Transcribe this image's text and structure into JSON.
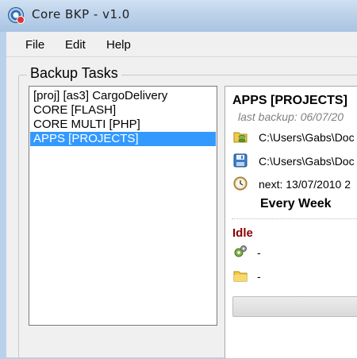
{
  "window": {
    "title": "Core BKP - v1.0"
  },
  "menu": {
    "file": "File",
    "edit": "Edit",
    "help": "Help"
  },
  "group": {
    "title": "Backup Tasks"
  },
  "tasks": [
    {
      "label": "[proj] [as3] CargoDelivery",
      "selected": false
    },
    {
      "label": "CORE [FLASH]",
      "selected": false
    },
    {
      "label": "CORE MULTI [PHP]",
      "selected": false
    },
    {
      "label": "APPS [PROJECTS]",
      "selected": true
    }
  ],
  "detail": {
    "title": "APPS [PROJECTS]",
    "last_backup": "last backup: 06/07/20",
    "source_path": "C:\\Users\\Gabs\\Doc",
    "dest_path": "C:\\Users\\Gabs\\Doc",
    "next": "next: 13/07/2010 2",
    "schedule": "Every Week",
    "status": "Idle",
    "activity": "-",
    "current_file": "-"
  },
  "icons": {
    "app": "core-bkp-app-icon",
    "source": "database-folder-icon",
    "dest": "floppy-disk-icon",
    "next": "clock-icon",
    "activity": "gears-icon",
    "file": "folder-icon"
  },
  "colors": {
    "selection": "#3399ff",
    "status_idle": "#8b0000"
  }
}
